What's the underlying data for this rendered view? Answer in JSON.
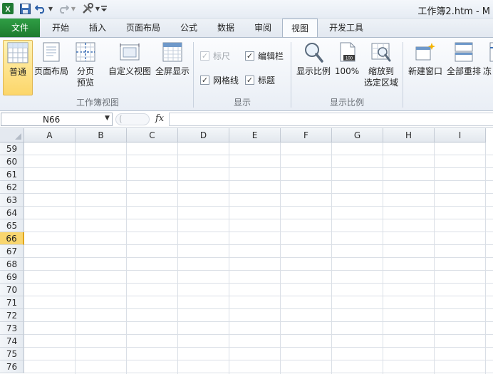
{
  "app": {
    "doc_title": "工作簿2.htm - M"
  },
  "quick_access": {
    "icons": [
      "excel-logo-icon",
      "save-icon",
      "undo-icon",
      "undo-dropdown-icon",
      "redo-icon",
      "redo-dropdown-icon",
      "tools-icon",
      "customize-qat-icon"
    ]
  },
  "tabs": [
    {
      "label": "文件",
      "state": "file"
    },
    {
      "label": "开始",
      "state": "normal"
    },
    {
      "label": "插入",
      "state": "normal"
    },
    {
      "label": "页面布局",
      "state": "normal"
    },
    {
      "label": "公式",
      "state": "normal"
    },
    {
      "label": "数据",
      "state": "normal"
    },
    {
      "label": "审阅",
      "state": "normal"
    },
    {
      "label": "视图",
      "state": "active"
    },
    {
      "label": "开发工具",
      "state": "normal"
    }
  ],
  "ribbon": {
    "workbook_views": {
      "group_label": "工作簿视图",
      "normal": "普通",
      "page_layout": "页面布局",
      "page_break_line1": "分页",
      "page_break_line2": "预览",
      "custom_views": "自定义视图",
      "full_screen": "全屏显示"
    },
    "show": {
      "group_label": "显示",
      "ruler": {
        "label": "标尺",
        "checked": true,
        "enabled": false
      },
      "formula_bar": {
        "label": "编辑栏",
        "checked": true,
        "enabled": true
      },
      "gridlines": {
        "label": "网格线",
        "checked": true,
        "enabled": true
      },
      "headings": {
        "label": "标题",
        "checked": true,
        "enabled": true
      }
    },
    "zoom": {
      "group_label": "显示比例",
      "zoom": "显示比例",
      "zoom_100": "100%",
      "zoom_selection_line1": "缩放到",
      "zoom_selection_line2": "选定区域"
    },
    "window": {
      "new_window": "新建窗口",
      "arrange_all": "全部重排",
      "freeze_partial": "冻"
    }
  },
  "formula_bar": {
    "name_box": "N66",
    "fx": "fx",
    "formula": ""
  },
  "sheet": {
    "columns": [
      "A",
      "B",
      "C",
      "D",
      "E",
      "F",
      "G",
      "H",
      "I"
    ],
    "rows": [
      "59",
      "60",
      "61",
      "62",
      "63",
      "64",
      "65",
      "66",
      "67",
      "68",
      "69",
      "70",
      "71",
      "72",
      "73",
      "74",
      "75",
      "76"
    ],
    "active_row": "66"
  },
  "colors": {
    "file_tab": "#2f9e44",
    "selected_button": "#fcd66a",
    "active_row_header": "#f9d66f"
  }
}
